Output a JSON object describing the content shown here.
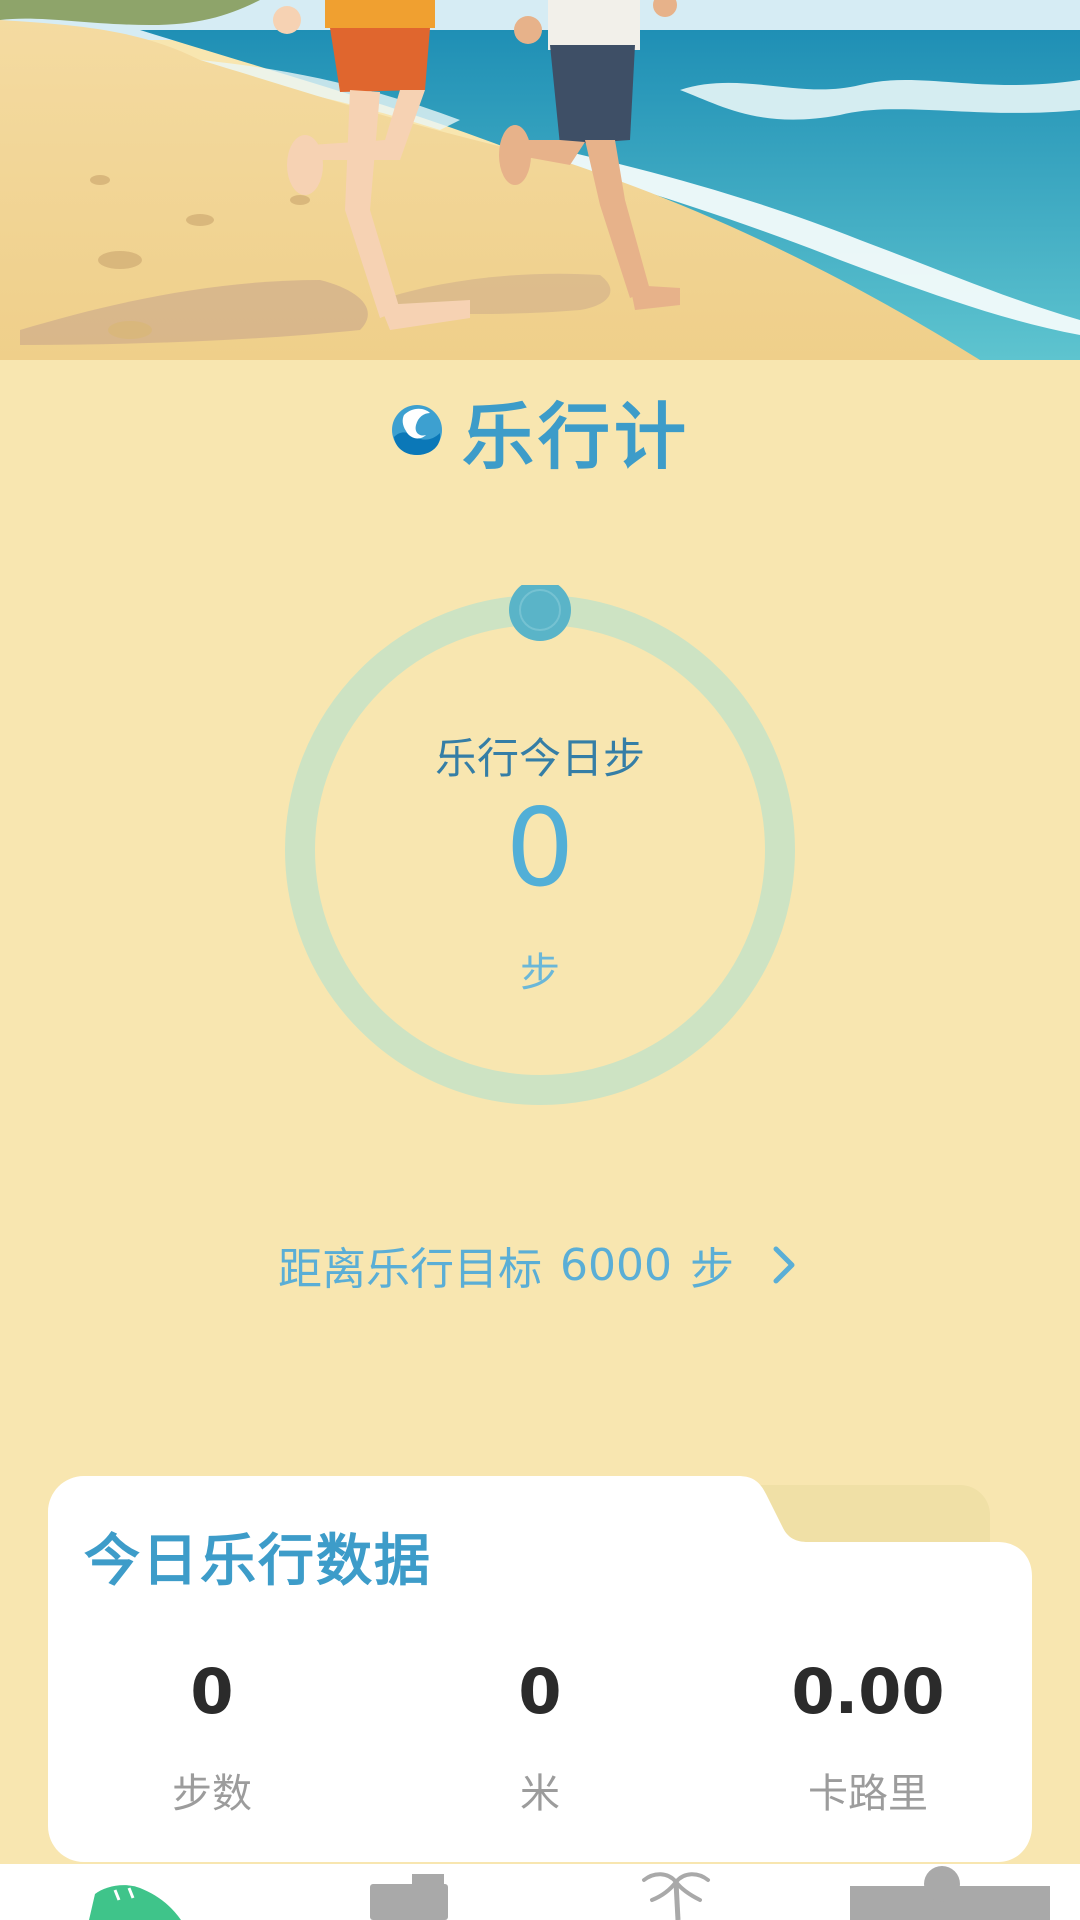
{
  "app": {
    "title": "乐行计"
  },
  "ring": {
    "label": "乐行今日步",
    "value": "0",
    "unit": "步",
    "progress": 0
  },
  "goal": {
    "prefix": "距离乐行目标",
    "steps": "6000",
    "unit": "步"
  },
  "today_card": {
    "title": "今日乐行数据",
    "stats": [
      {
        "value": "0",
        "label": "步数"
      },
      {
        "value": "0",
        "label": "米"
      },
      {
        "value": "0.00",
        "label": "卡路里"
      }
    ]
  },
  "tabbar": {
    "icons": [
      "shoe-icon",
      "truck-icon",
      "palm-tree-icon",
      "profile-icon"
    ],
    "active": 0
  },
  "colors": {
    "background": "#f8e6b0",
    "accent": "#3d9cc9",
    "ring_track": "#cde3c3",
    "ring_knob": "#5ab4c8",
    "active_tab": "#3fc48a"
  },
  "hero": {
    "image": "beach-running-illustration"
  }
}
